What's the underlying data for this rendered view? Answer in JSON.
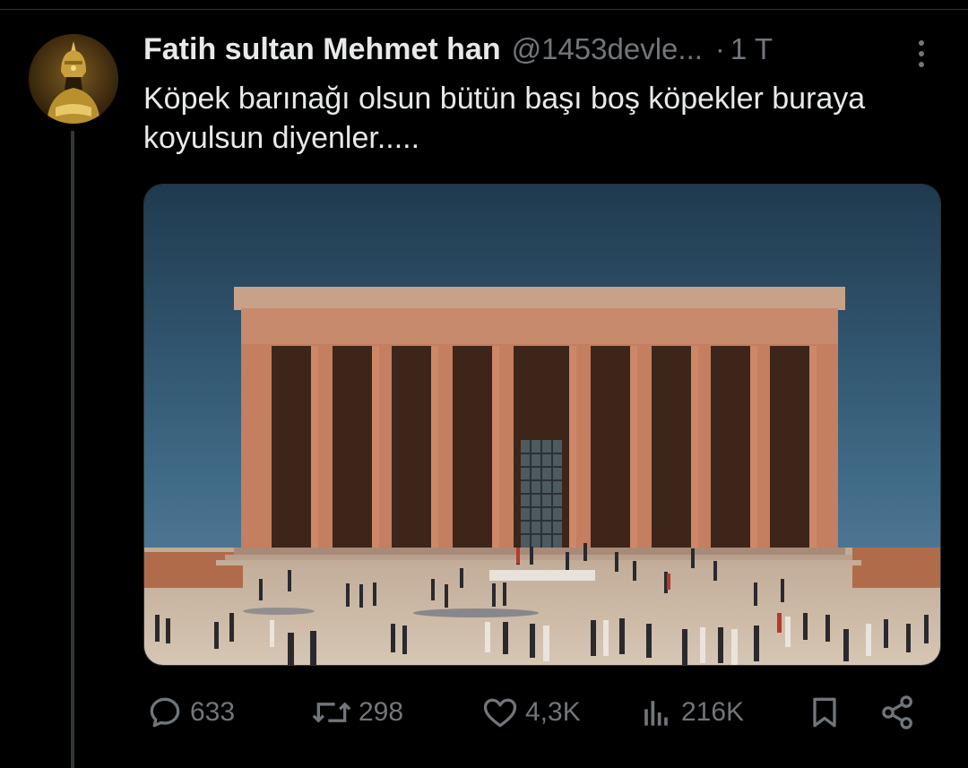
{
  "tweet": {
    "author": {
      "display_name": "Fatih sultan Mehmet han",
      "handle": "@1453devle...",
      "avatar_icon": "sultan-portrait"
    },
    "separator": "·",
    "time": "1 T",
    "more_icon": "more-vertical-icon",
    "text": "Köpek barınağı olsun bütün başı boş köpekler buraya koyulsun diyenler.....",
    "media": {
      "type": "photo",
      "subject": "monumental colonnaded mausoleum with crowd on plaza"
    },
    "actions": {
      "replies": {
        "icon": "reply-icon",
        "count": "633"
      },
      "reposts": {
        "icon": "repost-icon",
        "count": "298"
      },
      "likes": {
        "icon": "heart-icon",
        "count": "4,3K"
      },
      "views": {
        "icon": "views-chart-icon",
        "count": "216K"
      },
      "bookmark": {
        "icon": "bookmark-icon"
      },
      "share": {
        "icon": "share-icon"
      }
    }
  },
  "colors": {
    "background": "#000000",
    "text_primary": "#e7e9ea",
    "text_secondary": "#71767b",
    "divider": "#2f3336"
  }
}
